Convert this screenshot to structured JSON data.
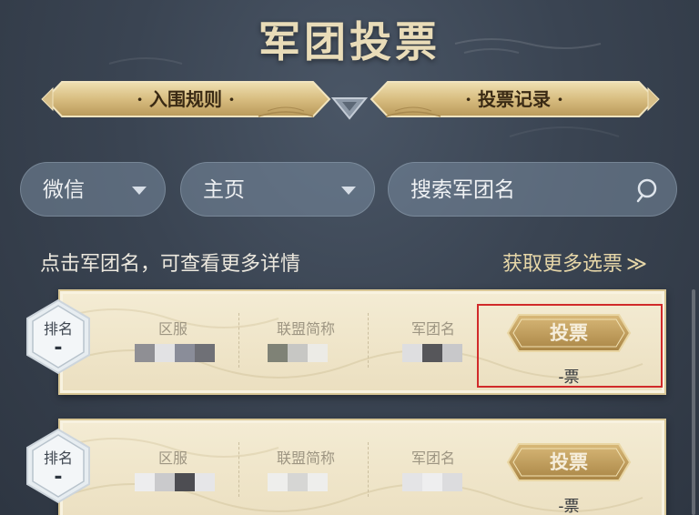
{
  "page": {
    "title": "军团投票"
  },
  "banners": {
    "left_label": "· 入围规则 ·",
    "right_label": "· 投票记录 ·"
  },
  "filters": {
    "platform": {
      "selected": "微信",
      "caret_icon": "caret-down-icon"
    },
    "scope": {
      "selected": "主页",
      "caret_icon": "caret-down-icon"
    },
    "search": {
      "placeholder": "搜索军团名",
      "icon": "search-icon"
    }
  },
  "hint_text": "点击军团名，可查看更多详情",
  "more_votes": {
    "label": "获取更多选票",
    "icon": "double-chevron-right-icon",
    "glyph": "≫"
  },
  "columns": {
    "server": "区服",
    "alliance": "联盟简称",
    "legion": "军团名"
  },
  "rows": [
    {
      "rank_label": "排名",
      "rank": "-",
      "vote_button": "投票",
      "votes": "-票"
    },
    {
      "rank_label": "排名",
      "rank": "-",
      "vote_button": "投票",
      "votes": "-票"
    }
  ],
  "colors": {
    "accent_gold": "#c9a45c",
    "highlight_red": "#d12a2a",
    "background": "#3a4452"
  }
}
